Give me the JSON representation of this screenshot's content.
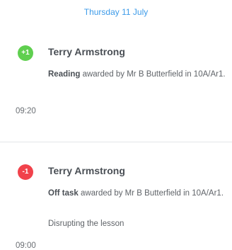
{
  "date_header": "Thursday 11 July",
  "colors": {
    "date_accent": "#3d9be9",
    "positive_badge": "#5fcf4f",
    "negative_badge": "#f1424b"
  },
  "items": [
    {
      "badge": "+1",
      "student": "Terry Armstrong",
      "behaviour": "Reading",
      "awarded_text": " awarded by Mr B Butterfield in 10A/Ar1.",
      "time": "09:20"
    },
    {
      "badge": "-1",
      "student": "Terry Armstrong",
      "behaviour": "Off task",
      "awarded_text": " awarded by Mr B Butterfield in 10A/Ar1.",
      "note": "Disrupting the lesson",
      "time": "09:00"
    }
  ]
}
